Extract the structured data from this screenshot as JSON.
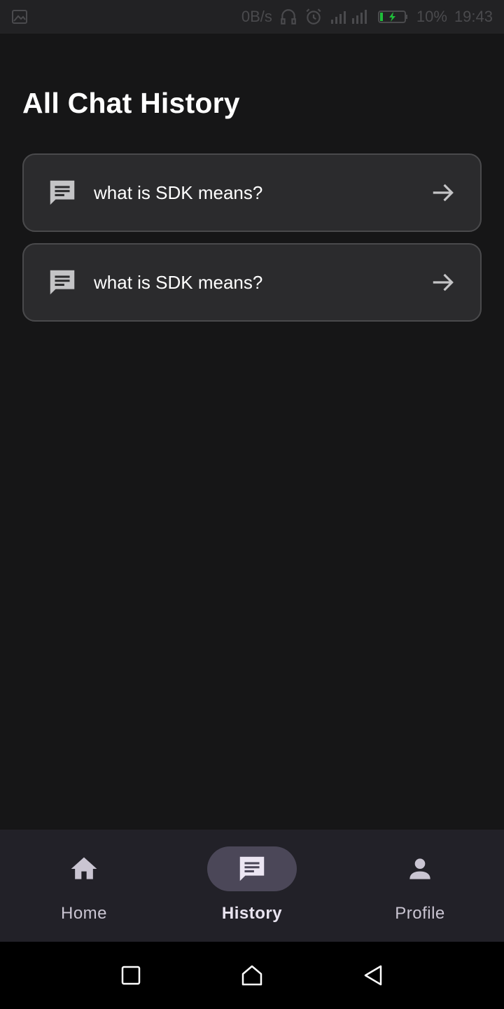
{
  "status_bar": {
    "net_speed": "0B/s",
    "battery": "10%",
    "time": "19:43",
    "battery_color": "#1fbf3a"
  },
  "page": {
    "title": "All Chat History"
  },
  "chats": [
    {
      "text": "what is SDK means?",
      "icon": "chat-bubble-icon",
      "action_icon": "arrow-right-icon"
    },
    {
      "text": "what is SDK means?",
      "icon": "chat-bubble-icon",
      "action_icon": "arrow-right-icon"
    }
  ],
  "bottom_nav": {
    "items": [
      {
        "label": "Home",
        "icon": "home-icon",
        "active": false
      },
      {
        "label": "History",
        "icon": "chat-icon",
        "active": true
      },
      {
        "label": "Profile",
        "icon": "person-icon",
        "active": false
      }
    ]
  },
  "system_nav": {
    "buttons": [
      "recents-icon",
      "home-icon",
      "back-icon"
    ]
  },
  "colors": {
    "background": "#161617",
    "card": "#2b2b2d",
    "card_border": "#4a4a4c",
    "nav_bg": "#222128",
    "nav_active_pill": "#4b4758"
  }
}
